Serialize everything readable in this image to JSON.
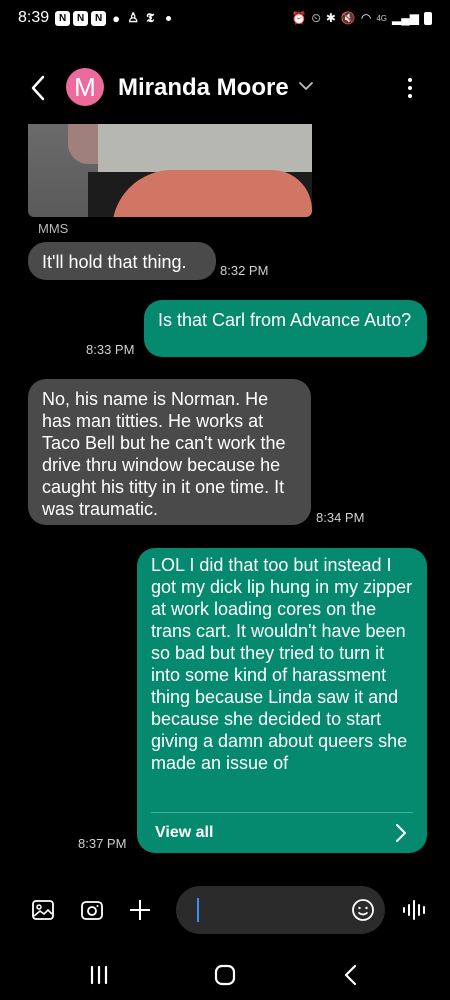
{
  "status_bar": {
    "time": "8:39",
    "network": "4G"
  },
  "header": {
    "avatar_letter": "M",
    "contact_name": "Miranda Moore"
  },
  "messages": [
    {
      "direction": "in",
      "text": "It'll hold that thing.",
      "time": "8:32 PM"
    },
    {
      "direction": "out",
      "text": "Is that Carl from Advance Auto?",
      "time": "8:33 PM"
    },
    {
      "direction": "in",
      "text": "No, his name is Norman. He has man titties. He works at Taco Bell but he can't work the drive thru window because he caught his titty in it one time. It was traumatic.",
      "time": "8:34 PM"
    },
    {
      "direction": "out",
      "text": "LOL I did that too but instead I got my dick lip hung in my zipper at work loading cores on the trans cart. It wouldn't have been so bad but they tried to turn it into some kind of harassment thing because Linda saw it and because she decided to start giving a damn about queers she made an issue of",
      "time": "8:37 PM",
      "view_all_label": "View all"
    }
  ],
  "mms": {
    "label": "MMS"
  },
  "composer": {
    "value": "",
    "placeholder": ""
  },
  "colors": {
    "background": "#000000",
    "incoming_bubble": "#4a4a4a",
    "outgoing_bubble": "#05896f",
    "avatar": "#ef6a9c",
    "cursor": "#3d8ef0"
  }
}
